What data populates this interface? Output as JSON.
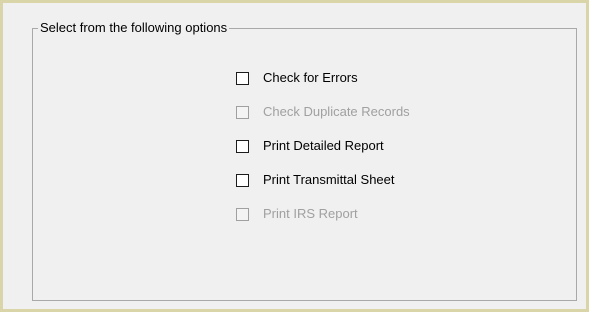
{
  "groupbox": {
    "title": "Select from the following options"
  },
  "options": [
    {
      "label": "Check for Errors",
      "checked": false,
      "enabled": true
    },
    {
      "label": "Check Duplicate Records",
      "checked": false,
      "enabled": false
    },
    {
      "label": "Print Detailed Report",
      "checked": false,
      "enabled": true
    },
    {
      "label": "Print Transmittal Sheet",
      "checked": false,
      "enabled": true
    },
    {
      "label": "Print IRS Report",
      "checked": false,
      "enabled": false
    }
  ],
  "colors": {
    "frame_border": "#d9d5a8",
    "panel_background": "#f0f0f0",
    "disabled_text": "#a0a0a0"
  }
}
